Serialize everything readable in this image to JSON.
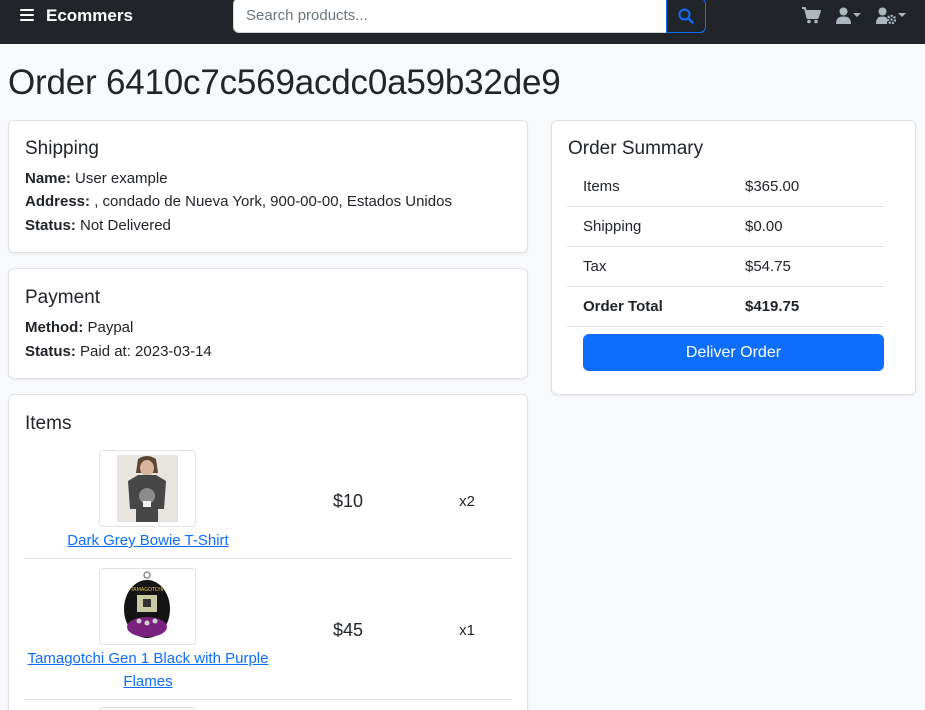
{
  "navbar": {
    "brand": "Ecommers",
    "search_placeholder": "Search products...",
    "icons": [
      "menu-icon",
      "search-icon",
      "cart-icon",
      "user-icon",
      "user-gear-icon"
    ]
  },
  "page": {
    "title": "Order 6410c7c569acdc0a59b32de9"
  },
  "shipping": {
    "heading": "Shipping",
    "name_label": "Name:",
    "name_value": " User example",
    "address_label": "Address:",
    "address_value": " , condado de Nueva York, 900-00-00, Estados Unidos",
    "status_label": "Status:",
    "status_value": " Not Delivered"
  },
  "payment": {
    "heading": "Payment",
    "method_label": "Method:",
    "method_value": " Paypal",
    "status_label": "Status:",
    "status_value": " Paid at: 2023-03-14"
  },
  "items": {
    "heading": "Items",
    "list": [
      {
        "name": "Dark Grey Bowie T-Shirt",
        "price": "$10",
        "qty": "x2"
      },
      {
        "name": "Tamagotchi Gen 1 Black with Purple Flames",
        "price": "$45",
        "qty": "x1"
      }
    ]
  },
  "summary": {
    "heading": "Order Summary",
    "rows": [
      {
        "label": "Items",
        "value": "$365.00"
      },
      {
        "label": "Shipping",
        "value": "$0.00"
      },
      {
        "label": "Tax",
        "value": "$54.75"
      },
      {
        "label": "Order Total",
        "value": "$419.75"
      }
    ],
    "deliver_label": "Deliver Order"
  },
  "colors": {
    "navbar_bg": "#212529",
    "primary": "#0d6efd",
    "page_bg": "#f8f9fa"
  }
}
